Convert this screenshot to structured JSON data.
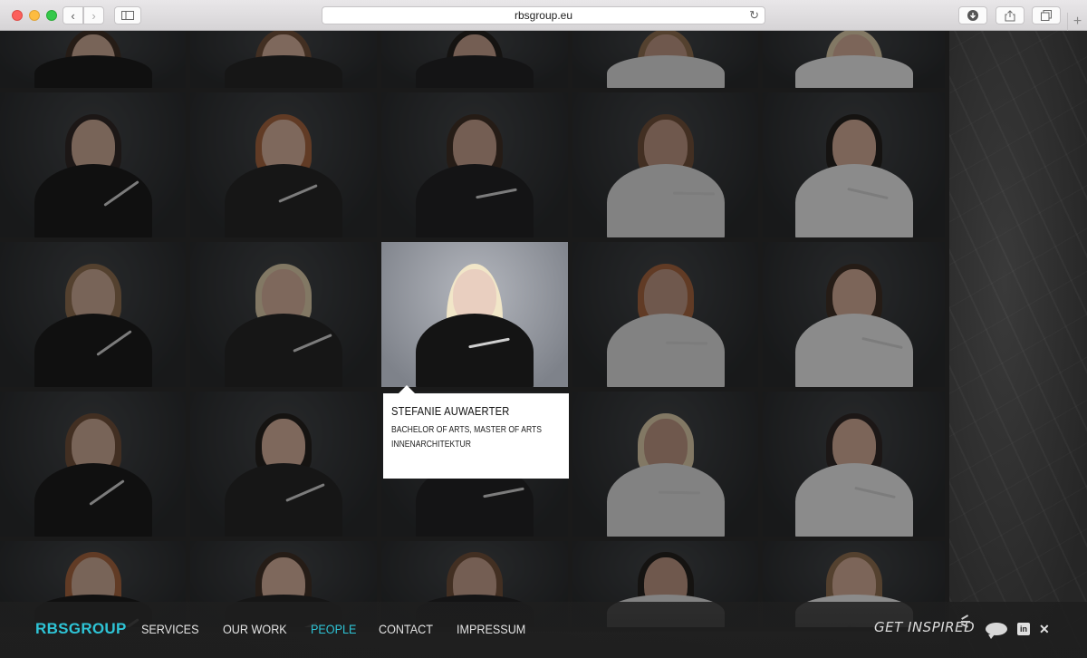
{
  "browser": {
    "url": "rbsgroup.eu",
    "back_icon": "chevron-left-icon",
    "forward_icon": "chevron-right-icon",
    "sidebar_icon": "sidebar-icon",
    "reload_icon": "reload-icon",
    "download_icon": "download-icon",
    "share_icon": "share-icon",
    "tabs_icon": "tabs-icon",
    "new_tab_icon": "plus-icon"
  },
  "team_grid": {
    "people": [
      {
        "row": 0,
        "col": 0
      },
      {
        "row": 0,
        "col": 1
      },
      {
        "row": 0,
        "col": 2
      },
      {
        "row": 0,
        "col": 3
      },
      {
        "row": 0,
        "col": 4
      },
      {
        "row": 1,
        "col": 0
      },
      {
        "row": 1,
        "col": 1
      },
      {
        "row": 1,
        "col": 2
      },
      {
        "row": 1,
        "col": 3
      },
      {
        "row": 1,
        "col": 4
      },
      {
        "row": 2,
        "col": 0
      },
      {
        "row": 2,
        "col": 1
      },
      {
        "row": 2,
        "col": 2,
        "active": true
      },
      {
        "row": 2,
        "col": 3
      },
      {
        "row": 2,
        "col": 4
      },
      {
        "row": 3,
        "col": 0
      },
      {
        "row": 3,
        "col": 1
      },
      {
        "row": 3,
        "col": 2
      },
      {
        "row": 3,
        "col": 3
      },
      {
        "row": 3,
        "col": 4
      },
      {
        "row": 4,
        "col": 0
      },
      {
        "row": 4,
        "col": 1
      },
      {
        "row": 4,
        "col": 2
      },
      {
        "row": 4,
        "col": 3
      },
      {
        "row": 4,
        "col": 4
      }
    ]
  },
  "selected_person": {
    "name": "STEFANIE AUWAERTER",
    "degree": "BACHELOR OF ARTS, MASTER OF ARTS",
    "field": "INNENARCHITEKTUR"
  },
  "footer": {
    "logo": "RBSGROUP",
    "nav": [
      {
        "label": "SERVICES"
      },
      {
        "label": "OUR WORK"
      },
      {
        "label": "PEOPLE",
        "active": true
      },
      {
        "label": "CONTACT"
      },
      {
        "label": "IMPRESSUM"
      }
    ],
    "tagline": "GET INSPIRED",
    "icons": [
      "chat-bubble-icon",
      "linkedin-icon",
      "xing-icon"
    ]
  },
  "colors": {
    "accent": "#2ec4d6",
    "background": "#242424"
  }
}
